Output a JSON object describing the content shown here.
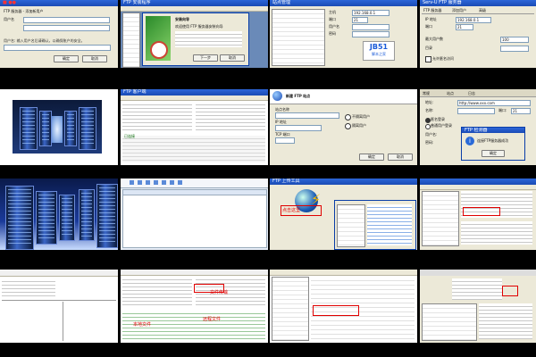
{
  "tiles": {
    "t11": {
      "title": "■ ●●",
      "heading": "FTP 服务器 - 添加新用户",
      "field_label": "用户名",
      "hint": "用户名: 输入用户名后请确认，以确保账户的安全。",
      "ok": "确定",
      "cancel": "取消"
    },
    "t12": {
      "title": "FTP 安装程序",
      "dialog_title": "安装向导",
      "dialog_text": "欢迎使用 FTP 服务器安装向导",
      "next": "下一步",
      "cancel": "取消"
    },
    "t13": {
      "title": "站点管理",
      "label_host": "主机",
      "label_port": "端口",
      "label_user": "用户名",
      "label_pass": "密码",
      "host_value": "192.168.0.1",
      "port_value": "21",
      "logo_text": "JB51",
      "logo_sub": "脚本之家"
    },
    "t14": {
      "title": "Serv-U FTP 服务器",
      "tab1": "FTP 服务器",
      "tab2": "添加用户",
      "tab3": "高级",
      "label1": "IP 地址",
      "label2": "端口",
      "label3": "最大用户数",
      "label4": "目录",
      "ip_value": "192.168.0.1",
      "port_value": "21",
      "max_value": "100",
      "checkbox": "允许匿名访问"
    },
    "t22": {
      "title": "FTP 客户端",
      "status": "已连接"
    },
    "t23": {
      "title": "新建 FTP 站点",
      "label1": "站点名称",
      "label2": "IP 地址",
      "label3": "TCP 端口",
      "option1": "不隔离用户",
      "option2": "隔离用户",
      "ok": "确定",
      "cancel": "取消"
    },
    "t24": {
      "tab1": "常规",
      "tab2": "站点",
      "tab3": "日志",
      "label_address": "地址:",
      "label_name": "名称:",
      "label_port": "端口:",
      "label_user": "用户名:",
      "label_pass": "密码:",
      "address_value": "http://www.xxx.com",
      "port_value": "21",
      "radio1": "匿名登录",
      "radio2": "普通用户登录",
      "dialog_title": "FTP 检测器",
      "dialog_text": "连接FTP服务器成功",
      "dialog_ok": "确定"
    },
    "t33": {
      "title": "FTP 上传工具",
      "annotation": "点击这里"
    },
    "t42": {
      "annotation1": "本地文件",
      "annotation2": "远程文件",
      "annotation3": "文件传输"
    }
  }
}
